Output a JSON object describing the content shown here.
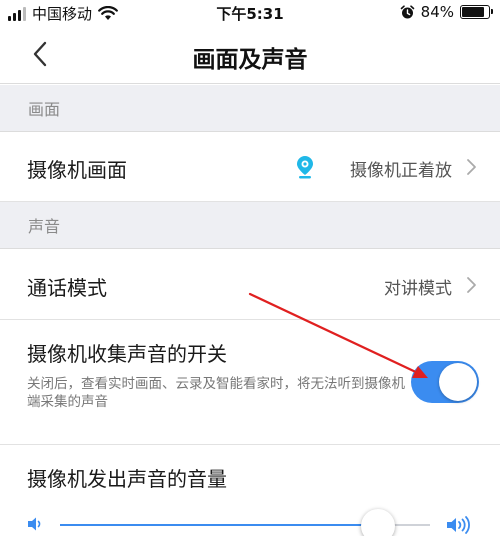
{
  "status_bar": {
    "carrier": "中国移动",
    "time": "下午5:31",
    "battery_text": "84%",
    "battery_level": 0.84
  },
  "nav": {
    "title": "画面及声音"
  },
  "sections": {
    "picture_header": "画面",
    "sound_header": "声音"
  },
  "picture": {
    "camera_view_label": "摄像机画面",
    "camera_view_value": "摄像机正着放"
  },
  "sound": {
    "call_mode_label": "通话模式",
    "call_mode_value": "对讲模式",
    "collect_label": "摄像机收集声音的开关",
    "collect_desc": "关闭后，查看实时画面、云录及智能看家时，将无法听到摄像机端采集的声音",
    "collect_enabled": true,
    "volume_label": "摄像机发出声音的音量",
    "volume_level": 0.86
  },
  "colors": {
    "accent": "#3b8cf0",
    "section_bg": "#eeeff3",
    "annotation_arrow": "#e02020"
  },
  "icons": {
    "back": "chevron-left-icon",
    "chevron": "chevron-right-icon",
    "camera": "camera-location-icon",
    "wifi": "wifi-icon",
    "alarm": "alarm-icon",
    "volume_low": "volume-low-icon",
    "volume_high": "volume-high-icon"
  }
}
